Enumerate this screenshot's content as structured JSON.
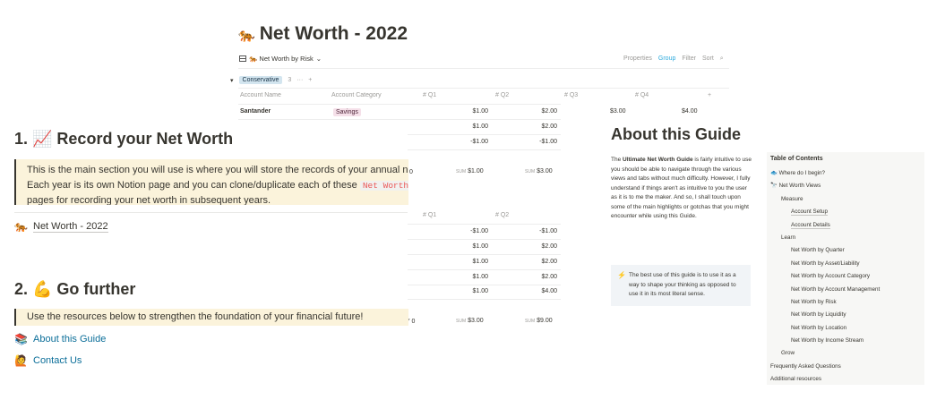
{
  "db": {
    "title_emoji": "🐅",
    "title": "Net Worth - 2022",
    "view_label": "🐅 Net Worth by Risk",
    "view_chevron": "⌄",
    "toolbar": {
      "properties": "Properties",
      "group": "Group",
      "filter": "Filter",
      "sort": "Sort",
      "search": "⌕"
    },
    "group": {
      "toggle": "▾",
      "name": "Conservative",
      "count": "3",
      "more": "···",
      "add": "+"
    },
    "columns": {
      "account_name": "Account Name",
      "account_category": "Account Category",
      "q1": "# Q1",
      "q2": "# Q2",
      "q3": "# Q3",
      "q4": "# Q4",
      "add": "+"
    },
    "row1": {
      "name": "Santander",
      "category": "Savings",
      "q1": "$1.00",
      "q2": "$2.00",
      "q3": "$3.00",
      "q4": "$4.00"
    },
    "rows_a": [
      {
        "q1": "$1.00",
        "q2": "$2.00"
      },
      {
        "q1": "-$1.00",
        "q2": "-$1.00"
      }
    ],
    "sum_a": {
      "prefix": "0",
      "label": "SUM",
      "q1": "$1.00",
      "q2": "$3.00"
    },
    "columns_b": {
      "q1": "# Q1",
      "q2": "# Q2"
    },
    "rows_b": [
      {
        "q1": "-$1.00",
        "q2": "-$1.00"
      },
      {
        "q1": "$1.00",
        "q2": "$2.00"
      },
      {
        "q1": "$1.00",
        "q2": "$2.00"
      },
      {
        "q1": "$1.00",
        "q2": "$2.00"
      },
      {
        "q1": "$1.00",
        "q2": "$4.00"
      }
    ],
    "sum_b": {
      "prefix": "Y 0",
      "label": "SUM",
      "q1": "$3.00",
      "q2": "$9.00"
    }
  },
  "guide": {
    "section1_title": "1. 📈 Record your Net Worth",
    "callout1_a": "This is the main section you will use is where you will store the records of your annual ne",
    "callout1_b": "Each year is its own Notion page and you can clone/duplicate each of these",
    "callout1_code": "Net Worth -",
    "callout1_c": "pages for recording your net worth in subsequent years.",
    "page_link": {
      "emoji": "🐅",
      "label": "Net Worth - 2022"
    },
    "section2_title": "2. 💪 Go further",
    "callout2": "Use the resources below to strengthen the foundation of your financial future!",
    "links": [
      {
        "emoji": "📚",
        "label": "About this Guide"
      },
      {
        "emoji": "🙋",
        "label": "Contact Us"
      }
    ]
  },
  "about": {
    "title": "About this Guide",
    "body_pre": "The ",
    "body_bold": "Ultimate Net Worth Guide",
    "body_post": " is fairly intuitive to use you should be able to navigate through the various views and tabs without much difficulty. However, I fully understand if things aren't as intuitive to you the user as it is to me the maker. And so, I shall touch upon some of the main highlights or gotchas that you might encounter while using this Guide.",
    "callout_icon": "⚡",
    "callout": "The best use of this guide is to use it as a way to shape your thinking as opposed to use it in its most literal sense.",
    "toc_title": "Table of Contents",
    "toc": [
      {
        "label": "🐟 Where do I begin?",
        "level": 1
      },
      {
        "label": "🔭 Net Worth Views",
        "level": 1
      },
      {
        "label": "Measure",
        "level": 2
      },
      {
        "label": "Account Setup",
        "level": 3,
        "u": true
      },
      {
        "label": "Account Details",
        "level": 3,
        "u": true
      },
      {
        "label": "Learn",
        "level": 2
      },
      {
        "label": "Net Worth by Quarter",
        "level": 3
      },
      {
        "label": "Net Worth by Asset/Liability",
        "level": 3
      },
      {
        "label": "Net Worth by Account Category",
        "level": 3
      },
      {
        "label": "Net Worth by Account Management",
        "level": 3
      },
      {
        "label": "Net Worth by Risk",
        "level": 3
      },
      {
        "label": "Net Worth by Liquidity",
        "level": 3
      },
      {
        "label": "Net Worth by Location",
        "level": 3
      },
      {
        "label": "Net Worth by Income Stream",
        "level": 3
      },
      {
        "label": "Grow",
        "level": 2
      },
      {
        "label": "Frequently Asked Questions",
        "level": 1
      },
      {
        "label": "Additional resources",
        "level": 1
      }
    ]
  }
}
